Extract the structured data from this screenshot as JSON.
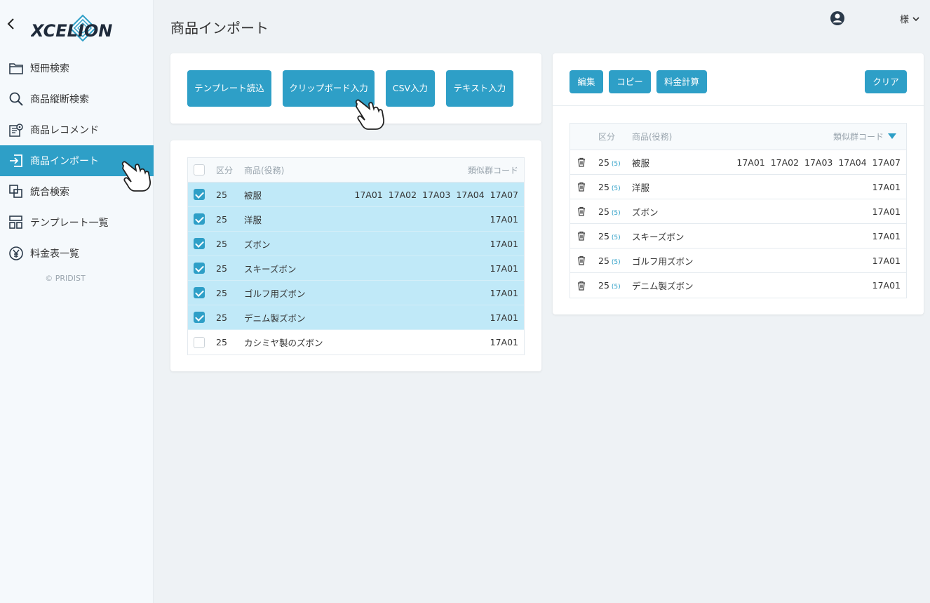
{
  "sidebar": {
    "back_icon": "chevron-left-icon",
    "logo_text": "XCELION",
    "items": [
      {
        "label": "短冊検索",
        "icon": "folder-icon",
        "active": false
      },
      {
        "label": "商品縦断検索",
        "icon": "search-icon",
        "active": false
      },
      {
        "label": "商品レコメンド",
        "icon": "recommend-icon",
        "active": false
      },
      {
        "label": "商品インポート",
        "icon": "import-icon",
        "active": true
      },
      {
        "label": "統合検索",
        "icon": "merge-icon",
        "active": false
      },
      {
        "label": "テンプレート一覧",
        "icon": "template-icon",
        "active": false
      },
      {
        "label": "料金表一覧",
        "icon": "yen-icon",
        "active": false
      }
    ],
    "copyright": "© PRIDIST"
  },
  "header": {
    "title": "商品インポート",
    "user_suffix": "様"
  },
  "import_panel": {
    "buttons": [
      "テンプレート読込",
      "クリップボード入力",
      "CSV入力",
      "テキスト入力"
    ]
  },
  "left_table": {
    "headers": {
      "kubun": "区分",
      "name": "商品(役務)",
      "code": "類似群コード"
    },
    "rows": [
      {
        "checked": true,
        "kubun": "25",
        "name": "被服",
        "codes": "17A01  17A02  17A03  17A04  17A07"
      },
      {
        "checked": true,
        "kubun": "25",
        "name": "洋服",
        "codes": "17A01"
      },
      {
        "checked": true,
        "kubun": "25",
        "name": "ズボン",
        "codes": "17A01"
      },
      {
        "checked": true,
        "kubun": "25",
        "name": "スキーズボン",
        "codes": "17A01"
      },
      {
        "checked": true,
        "kubun": "25",
        "name": "ゴルフ用ズボン",
        "codes": "17A01"
      },
      {
        "checked": true,
        "kubun": "25",
        "name": "デニム製ズボン",
        "codes": "17A01"
      },
      {
        "checked": false,
        "kubun": "25",
        "name": "カシミヤ製のズボン",
        "codes": "17A01"
      }
    ]
  },
  "right_panel": {
    "buttons": {
      "edit": "編集",
      "copy": "コピー",
      "calc": "料金計算",
      "clear": "クリア"
    },
    "headers": {
      "kubun": "区分",
      "name": "商品(役務)",
      "code": "類似群コード"
    },
    "rows": [
      {
        "kubun": "25",
        "count": "(5)",
        "name": "被服",
        "codes": "17A01  17A02  17A03  17A04  17A07"
      },
      {
        "kubun": "25",
        "count": "(5)",
        "name": "洋服",
        "codes": "17A01"
      },
      {
        "kubun": "25",
        "count": "(5)",
        "name": "ズボン",
        "codes": "17A01"
      },
      {
        "kubun": "25",
        "count": "(5)",
        "name": "スキーズボン",
        "codes": "17A01"
      },
      {
        "kubun": "25",
        "count": "(5)",
        "name": "ゴルフ用ズボン",
        "codes": "17A01"
      },
      {
        "kubun": "25",
        "count": "(5)",
        "name": "デニム製ズボン",
        "codes": "17A01"
      }
    ]
  },
  "colors": {
    "accent": "#2e9fc7",
    "selected_row": "#c0e9f8",
    "background": "#eef2f5"
  }
}
